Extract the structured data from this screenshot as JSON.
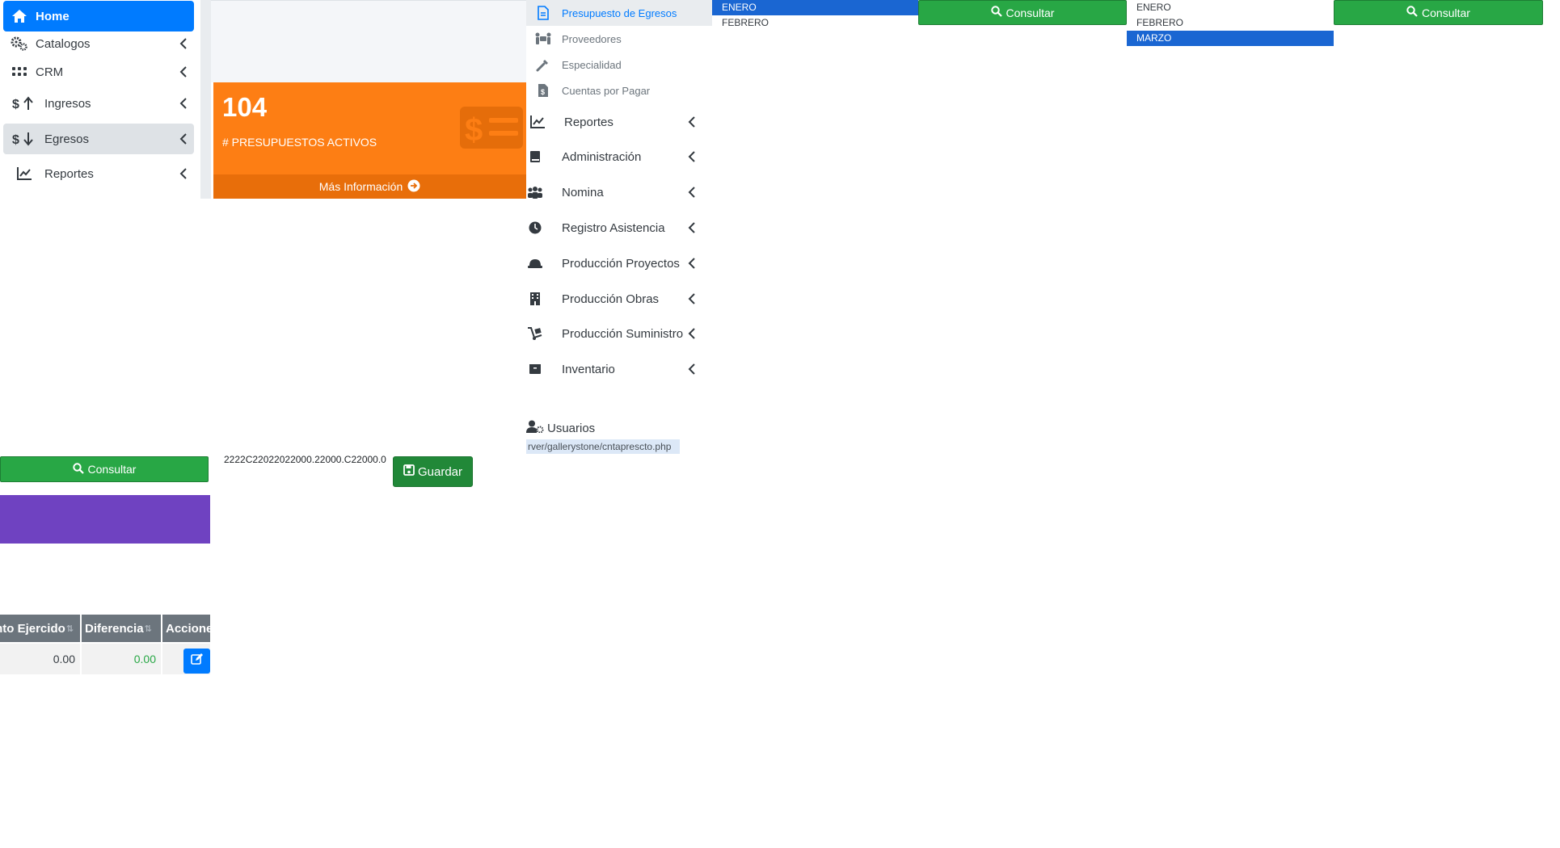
{
  "sidebar": {
    "items": [
      {
        "label": "Home",
        "icon": "home-icon"
      },
      {
        "label": "Catalogos",
        "icon": "cogs-icon"
      },
      {
        "label": "CRM",
        "icon": "grid-icon"
      },
      {
        "label": "Ingresos",
        "icon": "dollar-up-icon"
      },
      {
        "label": "Egresos",
        "icon": "dollar-down-icon"
      },
      {
        "label": "Reportes",
        "icon": "chart-line-icon"
      }
    ]
  },
  "smallbox": {
    "value": "104",
    "caption": "# PRESUPUESTOS ACTIVOS",
    "footer": "Más Información",
    "color": "#fd7e14"
  },
  "submenu": {
    "items": [
      {
        "label": "Presupuesto de Egresos",
        "icon": "file-invoice-icon"
      },
      {
        "label": "Proveedores",
        "icon": "people-carry-icon"
      },
      {
        "label": "Especialidad",
        "icon": "tools-icon"
      },
      {
        "label": "Cuentas por Pagar",
        "icon": "file-invoice-dollar-icon"
      }
    ]
  },
  "menu": {
    "items": [
      {
        "label": "Reportes",
        "icon": "chart-line-icon"
      },
      {
        "label": "Administración",
        "icon": "book-icon"
      },
      {
        "label": "Nomina",
        "icon": "users-icon"
      },
      {
        "label": "Registro Asistencia",
        "icon": "clock-icon"
      },
      {
        "label": "Producción Proyectos",
        "icon": "hard-hat-icon"
      },
      {
        "label": "Producción Obras",
        "icon": "building-icon"
      },
      {
        "label": "Producción Suministro",
        "icon": "dolly-icon"
      },
      {
        "label": "Inventario",
        "icon": "box-icon"
      }
    ],
    "usuarios": "Usuarios",
    "url": "rver/gallerystone/cntaprescto.php"
  },
  "months_a": [
    "ENERO",
    "FEBRERO"
  ],
  "months_b": [
    "ENERO",
    "FEBRERO",
    "MARZO"
  ],
  "buttons": {
    "consultar": "Consultar",
    "guardar": "Guardar"
  },
  "typed_value": "2222C22022022000.22000.C22000.0",
  "table": {
    "headers": [
      "nto Ejercido",
      "Diferencia",
      "Acciones"
    ],
    "row": {
      "ejercido": "0.00",
      "diferencia": "0.00"
    }
  },
  "colors": {
    "primary": "#007bff",
    "success": "#28a745",
    "purple": "#6f42c1",
    "selection": "#1a66d2"
  }
}
